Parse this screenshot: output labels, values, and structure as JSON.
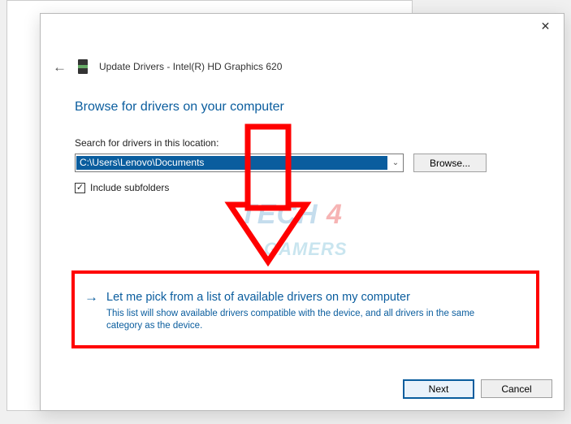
{
  "window": {
    "title": "Update Drivers - Intel(R) HD Graphics 620",
    "heading": "Browse for drivers on your computer",
    "close": "✕"
  },
  "search": {
    "label": "Search for drivers in this location:",
    "path": "C:\\Users\\Lenovo\\Documents",
    "browse": "Browse...",
    "include_subfolders_label": "Include subfolders",
    "include_subfolders_checked": "✓"
  },
  "pick": {
    "title": "Let me pick from a list of available drivers on my computer",
    "desc": "This list will show available drivers compatible with the device, and all drivers in the same category as the device."
  },
  "footer": {
    "next": "Next",
    "cancel": "Cancel"
  },
  "watermark": {
    "t1": "TECH",
    "t2": "4",
    "t3": "GAMERS"
  }
}
